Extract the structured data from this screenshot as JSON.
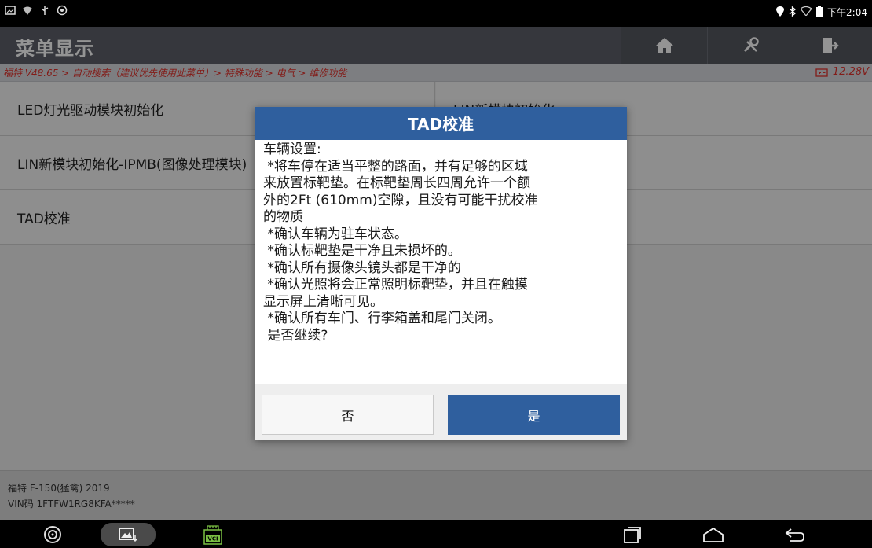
{
  "status_bar": {
    "time": "下午2:04"
  },
  "header": {
    "title": "菜单显示"
  },
  "toolbar": {
    "home_icon": "home-icon",
    "tools_icon": "tools-icon",
    "exit_icon": "exit-icon"
  },
  "breadcrumb": "福特 V48.65 > 自动搜索（建议优先使用此菜单）> 特殊功能 > 电气 > 维修功能",
  "voltage": "12.28V",
  "menu": {
    "items": [
      {
        "label": "LED灯光驱动模块初始化"
      },
      {
        "label": "LIN新模块初始化"
      },
      {
        "label": "LIN新模块初始化-IPMB(图像处理模块)"
      },
      {
        "label": "TAD校准"
      }
    ]
  },
  "footer": {
    "vehicle": "福特 F-150(猛禽) 2019",
    "vin": "VIN码 1FTFW1RG8KFA*****"
  },
  "dialog": {
    "title": "TAD校准",
    "lines": [
      "车辆设置:",
      " *将车停在适当平整的路面，并有足够的区域",
      "来放置标靶垫。在标靶垫周长四周允许一个额",
      "外的2Ft (610mm)空隙，且没有可能干扰校准",
      "的物质",
      " *确认车辆为驻车状态。",
      " *确认标靶垫是干净且未损坏的。",
      " *确认所有摄像头镜头都是干净的",
      " *确认光照将会正常照明标靶垫，并且在触摸",
      "显示屏上清晰可见。",
      " *确认所有车门、行李箱盖和尾门关闭。",
      " 是否继续?"
    ],
    "no_label": "否",
    "yes_label": "是"
  },
  "navbar": {
    "vci_label": "VCI"
  },
  "colors": {
    "accent": "#2f5f9e",
    "titlebar": "#5d606a",
    "crumb_text": "#e1312b"
  }
}
